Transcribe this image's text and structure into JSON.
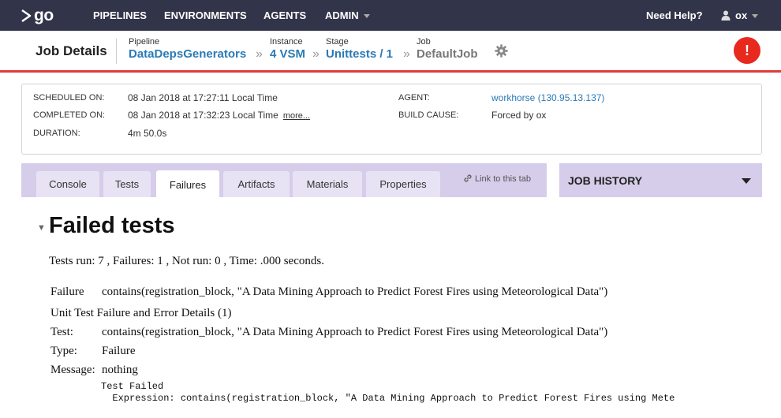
{
  "nav": {
    "logo": "go",
    "items": [
      "PIPELINES",
      "ENVIRONMENTS",
      "AGENTS",
      "ADMIN"
    ],
    "help": "Need Help?",
    "user": "ox"
  },
  "header": {
    "title": "Job Details",
    "breadcrumbs": [
      {
        "label": "Pipeline",
        "value": "DataDepsGenerators"
      },
      {
        "label": "Instance",
        "value": "4 VSM"
      },
      {
        "label": "Stage",
        "value": "Unittests / 1"
      },
      {
        "label": "Job",
        "value": "DefaultJob"
      }
    ],
    "alert_icon": "!"
  },
  "info": {
    "scheduled_label": "SCHEDULED ON:",
    "scheduled_value": "08 Jan 2018 at 17:27:11 Local Time",
    "completed_label": "COMPLETED ON:",
    "completed_value": "08 Jan 2018 at 17:32:23 Local Time",
    "more": "more...",
    "duration_label": "DURATION:",
    "duration_value": "4m 50.0s",
    "agent_label": "AGENT:",
    "agent_value": "workhorse (130.95.13.137)",
    "cause_label": "BUILD CAUSE:",
    "cause_value": "Forced by ox"
  },
  "tabs": [
    "Console",
    "Tests",
    "Failures",
    "Artifacts",
    "Materials",
    "Properties"
  ],
  "active_tab": "Failures",
  "link_tab": "Link to this tab",
  "job_history": "JOB HISTORY",
  "failures": {
    "title": "Failed tests",
    "summary": "Tests run: 7 , Failures: 1 , Not run: 0 , Time: .000 seconds.",
    "failure_label": "Failure",
    "failure_value": "contains(registration_block, \"A Data Mining Approach to Predict Forest Fires using Meteorological Data\")",
    "details_heading": "Unit Test Failure and Error Details (1)",
    "test_label": "Test:",
    "test_value": "contains(registration_block, \"A Data Mining Approach to Predict Forest Fires using Meteorological Data\")",
    "type_label": "Type:",
    "type_value": "Failure",
    "message_label": "Message:",
    "message_value": "nothing",
    "trace_line1": "Test Failed",
    "trace_line2": "  Expression: contains(registration_block, \"A Data Mining Approach to Predict Forest Fires using Mete"
  }
}
